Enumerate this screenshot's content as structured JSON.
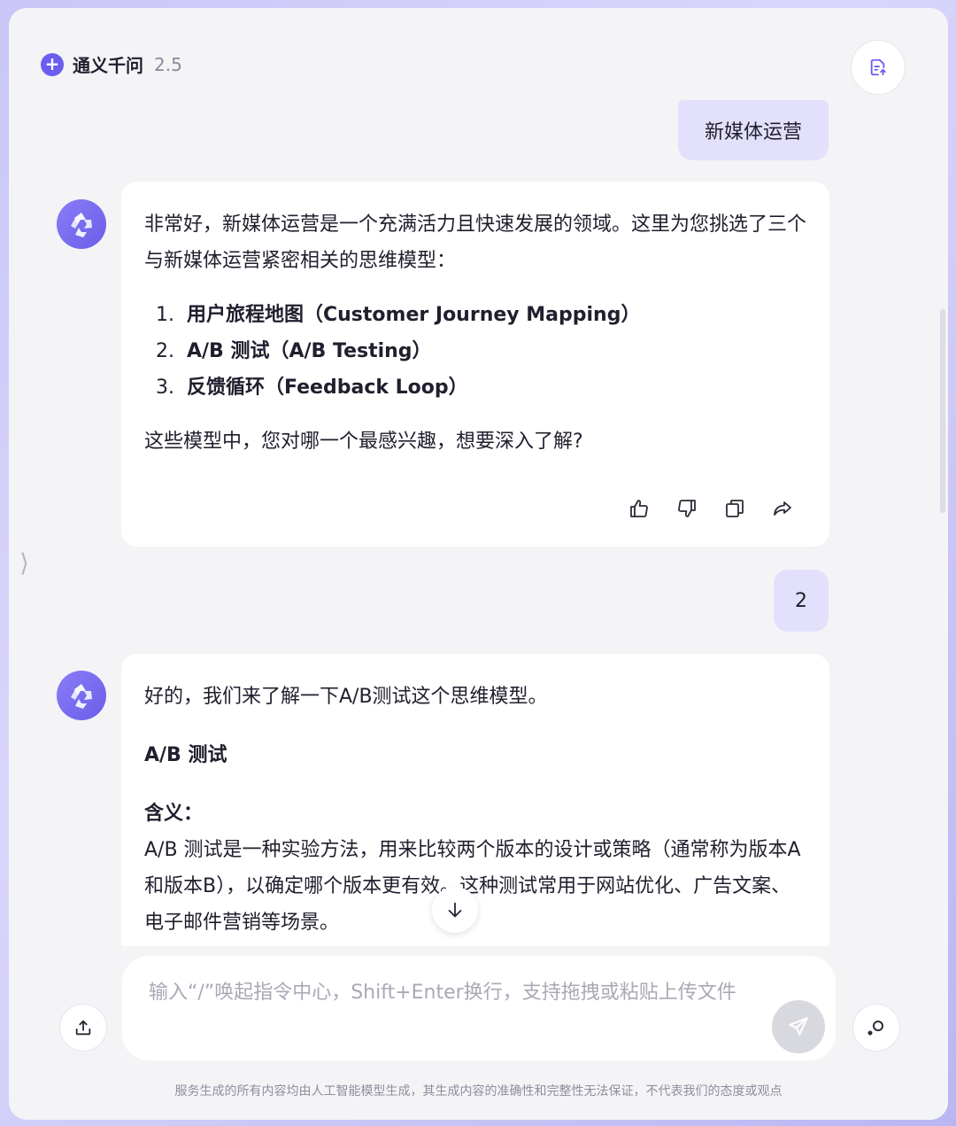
{
  "header": {
    "title": "通义千问",
    "version": "2.5",
    "new_chat_icon": "plus-icon",
    "history_icon": "document-icon"
  },
  "messages": {
    "user1": "新媒体运营",
    "assistant1": {
      "intro": "非常好，新媒体运营是一个充满活力且快速发展的领域。这里为您挑选了三个与新媒体运营紧密相关的思维模型：",
      "items": [
        {
          "num": "1.",
          "text": "用户旅程地图（Customer Journey Mapping）"
        },
        {
          "num": "2.",
          "text": "A/B 测试（A/B Testing）"
        },
        {
          "num": "3.",
          "text": "反馈循环（Feedback Loop）"
        }
      ],
      "question": "这些模型中，您对哪一个最感兴趣，想要深入了解?",
      "actions": [
        "thumbs-up-icon",
        "thumbs-down-icon",
        "copy-icon",
        "share-icon"
      ]
    },
    "user2": "2",
    "assistant2": {
      "intro": "好的，我们来了解一下A/B测试这个思维模型。",
      "section_title": "A/B 测试",
      "definition_title": "含义：",
      "definition": "A/B 测试是一种实验方法，用来比较两个版本的设计或策略（通常称为版本A和版本B），以确定哪个版本更有效。这种测试常用于网站优化、广告文案、电子邮件营销等场景。"
    }
  },
  "composer": {
    "placeholder": "输入“/”唤起指令中心，Shift+Enter换行，支持拖拽或粘贴上传文件",
    "value": ""
  },
  "disclaimer": "服务生成的所有内容均由人工智能模型生成，其生成内容的准确性和完整性无法保证，不代表我们的态度或观点",
  "colors": {
    "accent": "#6a5ef0",
    "user_bubble": "#e3e0fb",
    "background": "#f4f4f7"
  }
}
